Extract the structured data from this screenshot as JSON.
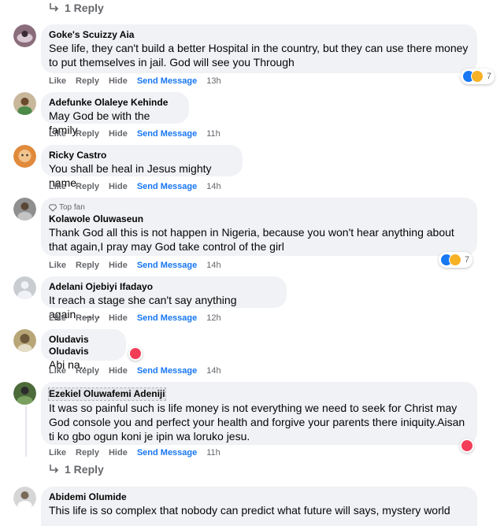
{
  "top_reply": {
    "label": "1 Reply"
  },
  "comments": [
    {
      "author": "Goke's Scuizzy Aia",
      "lines": [
        "See life, they can't build a better Hospital in the country, but they can use there money",
        "to put themselves in jail. God will see you Through"
      ],
      "time": "13h",
      "reactions": {
        "types": [
          "like-icon",
          "haha-icon"
        ],
        "count": "7"
      }
    },
    {
      "author": "Adefunke Olaleye Kehinde",
      "lines": [
        "May God be with the family"
      ],
      "time": "11h"
    },
    {
      "author": "Ricky Castro",
      "lines": [
        "You shall be heal in Jesus mighty name"
      ],
      "time": "14h"
    },
    {
      "author": "Kolawole Oluwaseun",
      "badge": "Top fan",
      "lines": [
        "Thank God all this is not happen in Nigeria, because you won't hear anything about",
        "that again,I pray may God take control of the girl"
      ],
      "time": "14h",
      "reactions": {
        "types": [
          "like-icon",
          "haha-icon"
        ],
        "count": "7"
      }
    },
    {
      "author": "Adelani Ojebiyi Ifadayo",
      "lines": [
        "It reach a stage she can't say anything again........"
      ],
      "time": "12h"
    },
    {
      "author": "Oludavis Oludavis",
      "lines": [
        "Abi na.."
      ],
      "time": "14h",
      "reactions": {
        "types": [
          "love-icon"
        ],
        "count": ""
      }
    },
    {
      "author": "Ezekiel Oluwafemi Adeniji",
      "lines": [
        "It was so painful such is life money is not everything we need to seek for Christ may",
        "God console you and perfect your health and forgive your parents there iniquity.Aisan",
        "ti ko gbo ogun koni je ipin wa loruko jesu."
      ],
      "time": "11h",
      "reactions": {
        "types": [
          "love-icon"
        ],
        "count": ""
      }
    },
    {
      "author": "Abidemi Olumide",
      "lines": [
        "This life is so complex that nobody can predict what future will says, mystery world"
      ],
      "time": ""
    }
  ],
  "bottom_reply": {
    "label": "1 Reply"
  },
  "actions": {
    "like": "Like",
    "reply": "Reply",
    "hide": "Hide",
    "send": "Send Message"
  },
  "colors": {
    "bubble": "#f0f2f5",
    "link": "#1877f2",
    "muted": "#65676b",
    "like": "#1877f2",
    "love": "#f33e58",
    "haha": "#f7b125"
  }
}
